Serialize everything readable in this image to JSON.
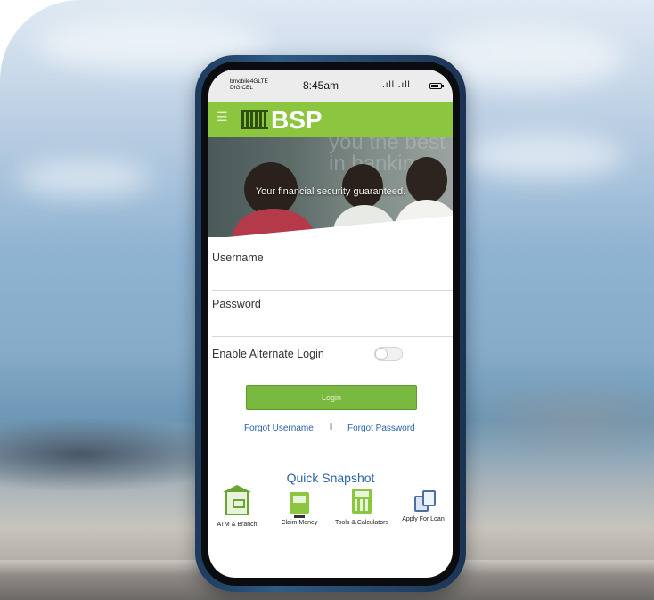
{
  "status_bar": {
    "carrier_line1": "bmobile4GLTE",
    "carrier_line2": "DIGICEL",
    "time": "8:45am",
    "signals": ".ıll .ıll"
  },
  "app_bar": {
    "brand": "BSP"
  },
  "hero": {
    "caption": "Your financial security guaranteed.",
    "bg_text": "you the best in banking"
  },
  "login_form": {
    "username_label": "Username",
    "username_value": "",
    "password_label": "Password",
    "password_value": "",
    "alternate_login_label": "Enable Alternate Login",
    "alternate_login_enabled": false,
    "login_button": "Login",
    "forgot_username": "Forgot Username",
    "separator": "I",
    "forgot_password": "Forgot Password"
  },
  "quick_snapshot": {
    "title": "Quick Snapshot",
    "items": [
      {
        "label": "ATM & Branch",
        "icon": "atm-branch-icon"
      },
      {
        "label": "Claim Money",
        "icon": "claim-money-icon"
      },
      {
        "label": "Tools & Calculators",
        "icon": "calculator-icon"
      },
      {
        "label": "Apply For Loan",
        "icon": "loan-documents-icon"
      }
    ]
  },
  "colors": {
    "brand_green": "#8cc63f",
    "button_green": "#7ab940",
    "link_blue": "#2a63a8"
  }
}
